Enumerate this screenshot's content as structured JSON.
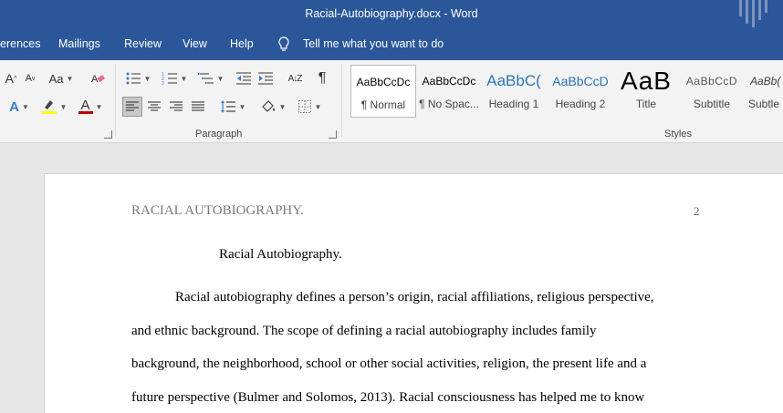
{
  "window": {
    "title": "Racial-Autobiography.docx  -  Word"
  },
  "menu": {
    "items": [
      "erences",
      "Mailings",
      "Review",
      "View",
      "Help"
    ],
    "tell_me": "Tell me what you want to do"
  },
  "ribbon": {
    "font_buttons": {
      "grow": "A",
      "shrink": "A",
      "case": "Aa",
      "effects": "A",
      "font_color": "A"
    },
    "paragraph_label": "Paragraph",
    "sort_label": "A↓Z",
    "pilcrow": "¶",
    "styles_label": "Styles",
    "styles": [
      {
        "preview": "AaBbCcDc",
        "label": "¶ Normal"
      },
      {
        "preview": "AaBbCcDc",
        "label": "¶ No Spac..."
      },
      {
        "preview": "AaBbC(",
        "label": "Heading 1"
      },
      {
        "preview": "AaBbCcD",
        "label": "Heading 2"
      },
      {
        "preview": "AaB",
        "label": "Title"
      },
      {
        "preview": "AaBbCcD",
        "label": "Subtitle"
      },
      {
        "preview": "AaBb(",
        "label": "Subtle"
      }
    ]
  },
  "document": {
    "header": "RACIAL AUTOBIOGRAPHY.",
    "page_number": "2",
    "title": "Racial Autobiography.",
    "lines": [
      "Racial autobiography defines a person’s origin, racial affiliations, religious perspective,",
      "and ethnic background. The scope of defining a racial autobiography includes family",
      "background, the neighborhood, school or other social activities, religion, the present life and a",
      "future perspective (Bulmer and Solomos, 2013). Racial consciousness has helped me to know"
    ]
  },
  "colors": {
    "accent": "#2b579a",
    "font_color_red": "#c00000",
    "highlight_yellow": "#ffff00"
  }
}
